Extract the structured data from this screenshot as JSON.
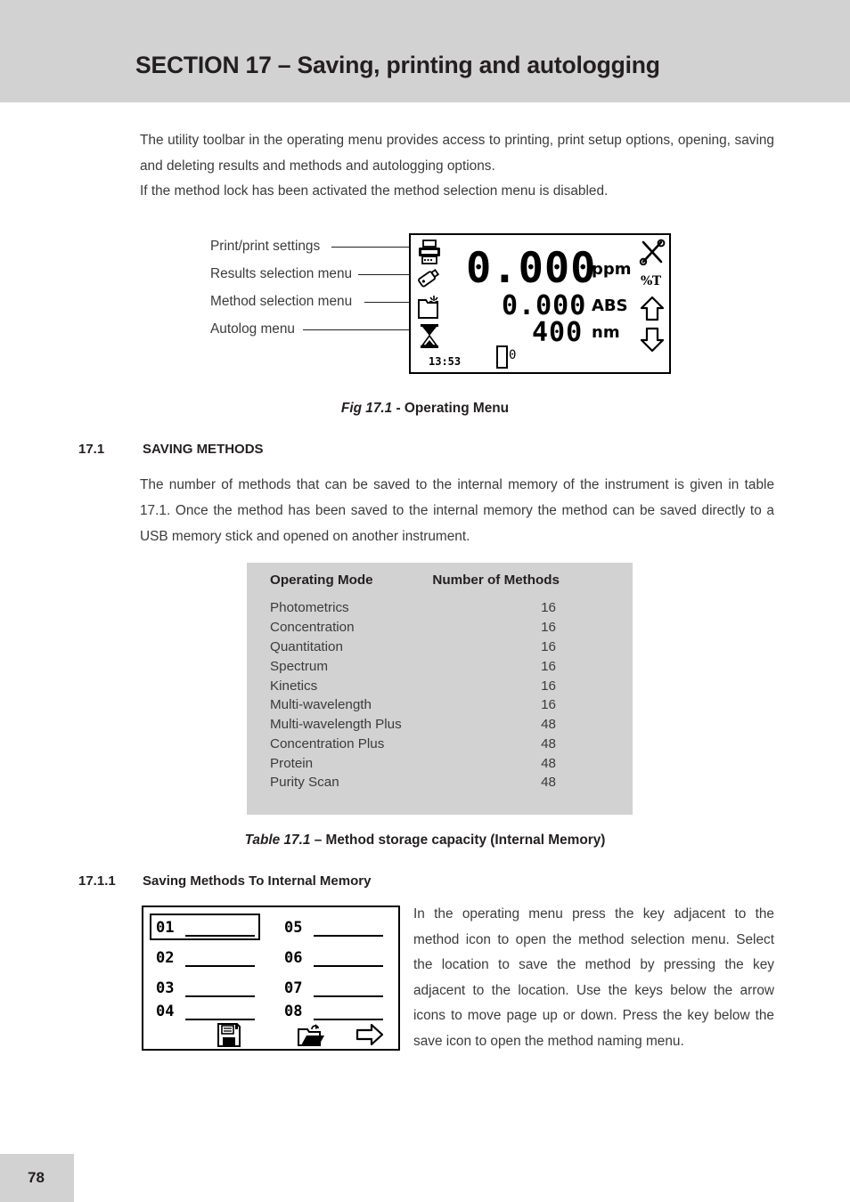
{
  "header": {
    "title": "SECTION 17 – Saving, printing and autologging"
  },
  "intro": {
    "paragraph_1": "The utility toolbar in the operating menu provides access to printing, print setup options, opening, saving and deleting results and methods and autologging options.",
    "paragraph_2": "If the method lock has been activated the method selection menu is disabled."
  },
  "figure_1": {
    "callouts": [
      "Print/print settings",
      "Results selection menu",
      "Method selection menu",
      "Autolog menu"
    ],
    "icons_left": [
      "printer-icon",
      "usb-stick-icon",
      "folder-method-icon",
      "hourglass-icon"
    ],
    "icons_right": [
      "tools-icon",
      "percent-t-label",
      "arrow-up-icon",
      "arrow-down-icon"
    ],
    "display": {
      "concentration_value": "0.000",
      "concentration_unit": "ppm",
      "absorbance_value": "0.000",
      "absorbance_unit": "ABS",
      "wavelength_value": "400",
      "wavelength_unit": "nm",
      "percent_t_label": "%T",
      "time": "13:53",
      "cell_position": "0"
    },
    "caption_prefix": "Fig 17.1",
    "caption_text": " - Operating Menu"
  },
  "section_17_1": {
    "number": "17.1",
    "title": "SAVING METHODS",
    "body": "The number of methods that can be saved to the internal memory of the instrument is given in table 17.1. Once the method has been saved to the internal memory the method can be saved directly to a USB memory stick and opened on another instrument."
  },
  "table": {
    "columns": [
      "Operating Mode",
      "Number of Methods"
    ],
    "rows": [
      [
        "Photometrics",
        "16"
      ],
      [
        "Concentration",
        "16"
      ],
      [
        "Quantitation",
        "16"
      ],
      [
        "Spectrum",
        "16"
      ],
      [
        "Kinetics",
        "16"
      ],
      [
        "Multi-wavelength",
        "16"
      ],
      [
        "Multi-wavelength Plus",
        "48"
      ],
      [
        "Concentration Plus",
        "48"
      ],
      [
        "Protein",
        "48"
      ],
      [
        "Purity Scan",
        "48"
      ]
    ],
    "caption_prefix": "Table 17.1",
    "caption_text": " – Method storage capacity (Internal Memory)"
  },
  "section_17_1_1": {
    "number": "17.1.1",
    "title": "Saving Methods To Internal Memory",
    "body": "In the operating menu press the key adjacent to the method icon to open the method selection menu. Select the location to save the method by pressing the key adjacent to the location. Use the keys below the arrow icons to move page up or down. Press the key below the save icon to open the method naming menu."
  },
  "figure_2": {
    "slots_left": [
      "01",
      "02",
      "03",
      "04"
    ],
    "slots_right": [
      "05",
      "06",
      "07",
      "08"
    ],
    "selected_slot": "01",
    "toolbar_icons": [
      "save-floppy-icon",
      "open-folder-icon",
      "next-arrow-icon"
    ]
  },
  "footer": {
    "page_number": "78"
  },
  "colors": {
    "header_gray": "#d2d2d2",
    "text": "#3b3b3b",
    "heading": "#231f20"
  }
}
